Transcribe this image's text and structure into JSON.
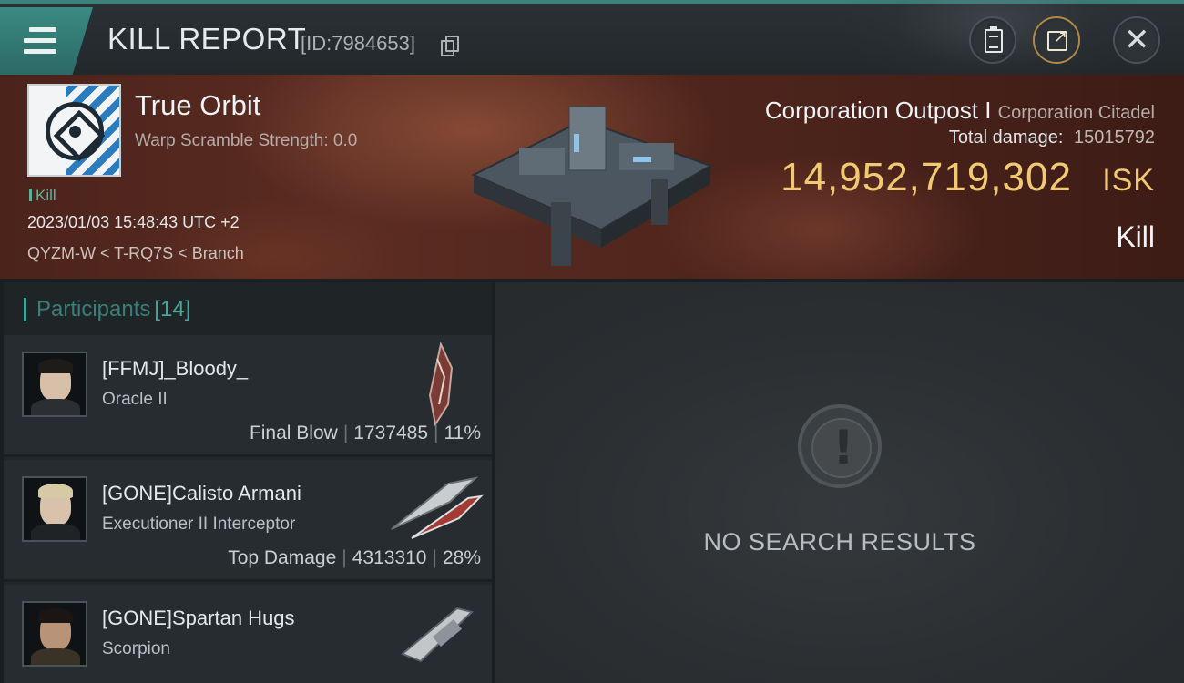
{
  "window": {
    "title": "KILL REPORT",
    "report_id": "[ID:7984653]",
    "icons": {
      "menu": "hamburger-menu-icon",
      "copy": "copy-icon",
      "clipboard": "clipboard-icon",
      "share": "share-icon",
      "close": "close-icon"
    }
  },
  "victim": {
    "corp_name": "True Orbit",
    "warp_scramble": "Warp Scramble Strength: 0.0",
    "result_tag": "Kill",
    "datetime": "2023/01/03 15:48:43 UTC +2",
    "location": "QYZM-W < T-RQ7S < Branch",
    "structure_name": "Corporation Outpost I",
    "structure_class": "Corporation Citadel",
    "total_damage_label": "Total damage:",
    "total_damage_value": "15015792",
    "isk_value": "14,952,719,302",
    "isk_currency": "ISK",
    "outcome": "Kill"
  },
  "participants": {
    "label": "Participants",
    "count": "[14]",
    "rows": [
      {
        "name": "[FFMJ]_Bloody_",
        "ship": "Oracle II",
        "role": "Final Blow",
        "damage": "1737485",
        "percent": "11%"
      },
      {
        "name": "[GONE]Calisto Armani",
        "ship": "Executioner II Interceptor",
        "role": "Top Damage",
        "damage": "4313310",
        "percent": "28%"
      },
      {
        "name": "[GONE]Spartan Hugs",
        "ship": "Scorpion",
        "role": "",
        "damage": "",
        "percent": ""
      }
    ]
  },
  "results": {
    "empty_text": "NO SEARCH RESULTS",
    "icon": "exclamation-icon"
  },
  "colors": {
    "accent_teal": "#3d7f79",
    "isk_gold": "#f2c973",
    "banner_red": "#4b231b"
  }
}
